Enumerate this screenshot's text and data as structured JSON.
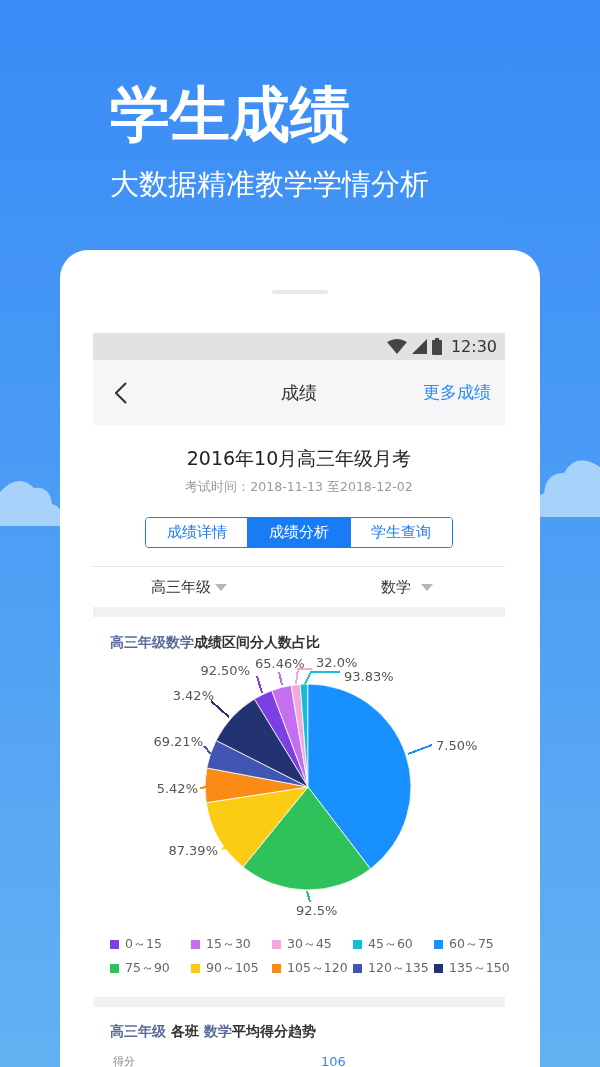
{
  "headline": "学生成绩",
  "tagline": "大数据精准教学学情分析",
  "status_bar": {
    "time": "12:30"
  },
  "nav": {
    "title": "成绩",
    "action": "更多成绩"
  },
  "exam": {
    "title": "2016年10月高三年级月考",
    "period": "考试时间：2018-11-13 至2018-12-02"
  },
  "tabs": [
    {
      "label": "成绩详情",
      "selected": false
    },
    {
      "label": "成绩分析",
      "selected": true
    },
    {
      "label": "学生查询",
      "selected": false
    }
  ],
  "filters": [
    {
      "label": "高三年级"
    },
    {
      "label": "数学"
    }
  ],
  "distribution": {
    "title_parts": [
      {
        "text": "高三年级数学",
        "highlight": true
      },
      {
        "text": "成绩区间分人数占比",
        "highlight": false
      }
    ],
    "slice_labels": [
      {
        "text": "92.50%",
        "color": "#7b3fe4"
      },
      {
        "text": "65.46%",
        "color": "#c46ff0"
      },
      {
        "text": "32.0%",
        "color": "#f4a8dc"
      },
      {
        "text": "93.83%",
        "color": "#14bcd8"
      },
      {
        "text": "3.42%",
        "color": "#223273"
      },
      {
        "text": "69.21%",
        "color": "#4056b0"
      },
      {
        "text": "7.50%",
        "color": "#1890ff"
      },
      {
        "text": "5.42%",
        "color": "#fa8c16"
      },
      {
        "text": "87.39%",
        "color": "#facc14"
      },
      {
        "text": "92.5%",
        "color": "#2fc25b"
      }
    ],
    "legend": [
      {
        "label": "0～15",
        "color": "#7b3fe4"
      },
      {
        "label": "15～30",
        "color": "#c46ff0"
      },
      {
        "label": "30～45",
        "color": "#f4a8dc"
      },
      {
        "label": "45～60",
        "color": "#14bcd8"
      },
      {
        "label": "60～75",
        "color": "#1890ff"
      },
      {
        "label": "75～90",
        "color": "#2fc25b"
      },
      {
        "label": "90～105",
        "color": "#facc14"
      },
      {
        "label": "105～120",
        "color": "#fa8c16"
      },
      {
        "label": "120～135",
        "color": "#4056b0"
      },
      {
        "label": "135～150",
        "color": "#223273"
      }
    ]
  },
  "trend": {
    "title_parts": [
      {
        "text": "高三年级",
        "highlight": true
      },
      {
        "text": " 各班 ",
        "highlight": false
      },
      {
        "text": "数学",
        "highlight": true
      },
      {
        "text": "平均得分趋势",
        "highlight": false
      }
    ],
    "ylabel": "得分",
    "value_label": "106"
  }
}
